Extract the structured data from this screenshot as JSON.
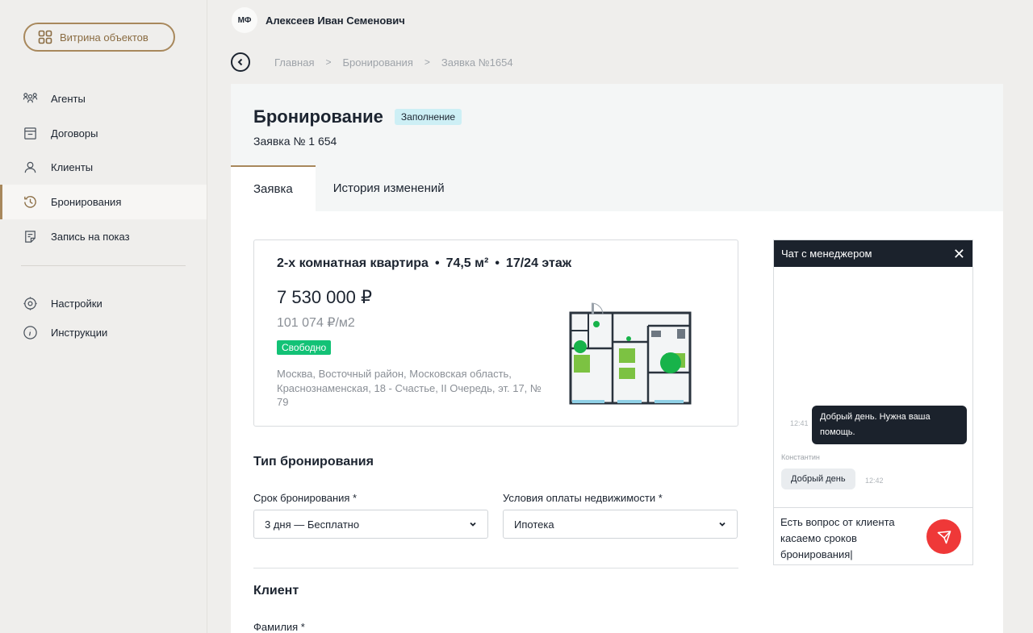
{
  "sidebar": {
    "vitrina_label": "Витрина объектов",
    "items": [
      {
        "label": "Агенты",
        "icon": "agents-icon"
      },
      {
        "label": "Договоры",
        "icon": "contracts-icon"
      },
      {
        "label": "Клиенты",
        "icon": "clients-icon"
      },
      {
        "label": "Бронирования",
        "icon": "booking-icon",
        "active": true
      },
      {
        "label": "Запись на показ",
        "icon": "showing-icon"
      }
    ],
    "secondary": [
      {
        "label": "Настройки",
        "icon": "settings-icon"
      },
      {
        "label": "Инструкции",
        "icon": "info-icon"
      }
    ]
  },
  "header": {
    "avatar_initials": "МФ",
    "user_name": "Алексеев Иван Семенович"
  },
  "breadcrumb": {
    "items": [
      "Главная",
      "Бронирования",
      "Заявка №1654"
    ],
    "separator": ">"
  },
  "page": {
    "title": "Бронирование",
    "status": "Заполнение",
    "subtitle": "Заявка № 1 654",
    "tabs": [
      "Заявка",
      "История изменений"
    ],
    "active_tab": 0
  },
  "property": {
    "type": "2-х комнатная квартира",
    "area": "74,5 м²",
    "floor": "17/24 этаж",
    "dot": "•",
    "price": "7 530 000 ₽",
    "price_per_m2": "101 074 ₽/м2",
    "status": "Свободно",
    "address": "Москва, Восточный район, Московская область, Краснознаменская, 18 - Счастье, II Очередь, эт. 17, № 79"
  },
  "booking_type": {
    "title": "Тип бронирования",
    "term_label": "Срок бронирования *",
    "term_value": "3 дня — Бесплатно",
    "payment_label": "Условия оплаты недвижимости *",
    "payment_value": "Ипотека"
  },
  "client": {
    "title": "Клиент",
    "surname_label": "Фамилия *"
  },
  "chat": {
    "title": "Чат с менеджером",
    "close": "✕",
    "messages": [
      {
        "direction": "out",
        "text": "Добрый день. Нужна ваша помощь.",
        "time": "12:41"
      },
      {
        "direction": "in",
        "author": "Константин",
        "text": "Добрый день",
        "time": "12:42"
      }
    ],
    "input_value": "Есть вопрос от клиента\nкасаемо сроков\nбронирования|"
  },
  "colors": {
    "accent": "#a8885c",
    "dark": "#1b222c",
    "green": "#13c276",
    "send": "#ef3838",
    "status_badge": "#cdeff5"
  }
}
